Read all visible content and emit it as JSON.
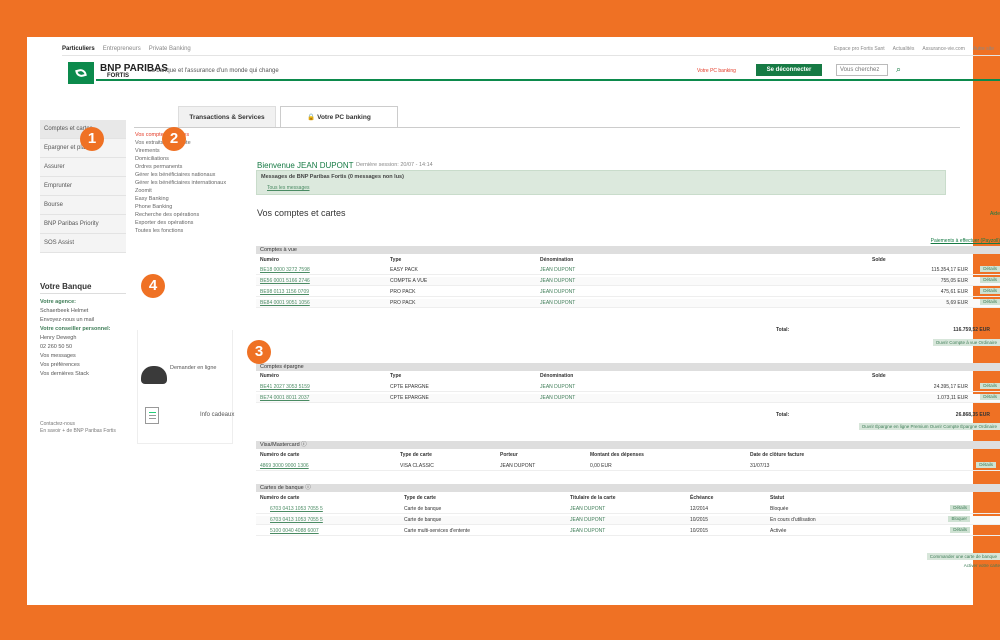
{
  "top_nav": [
    "Particuliers",
    "Entrepreneurs",
    "Private Banking"
  ],
  "top_links": [
    "Espace pro Fortis Sant",
    "Actualités",
    "Assurance-vie.com",
    "Autre site"
  ],
  "brand": {
    "line1": "BNP PARIBAS",
    "line2": "FORTIS",
    "tagline": "La banque et l'assurance d'un monde qui change"
  },
  "header": {
    "pc_link": "Votre PC banking",
    "logout": "Se déconnecter",
    "search_placeholder": "Vous cherchez"
  },
  "left_nav": [
    "Comptes et cartes",
    "Epargner et placer",
    "Assurer",
    "Emprunter",
    "Bourse",
    "BNP Paribas Priority",
    "SOS Assist"
  ],
  "votre_banque": {
    "title": "Votre Banque",
    "agence_label": "Votre agence:",
    "agence": "Schaerbeek Helmet",
    "contact": "Envoyez-nous un mail",
    "conseiller_label": "Votre conseiller personnel:",
    "conseiller": "Henry Dewegh",
    "phone": "02 260 50 50",
    "l1": "Vos messages",
    "l2": "Vos préférences",
    "l3": "Vos dernières Stack"
  },
  "left_under": {
    "l1": "Contactez-nous",
    "l2": "En savoir + de BNP Paribas Fortis"
  },
  "tabs": {
    "t1": "Transactions & Services",
    "t2": "Votre PC banking"
  },
  "menu": [
    "Vos comptes et cartes",
    "Vos extraits de compte",
    "Virements",
    "Domiciliations",
    "Ordres permanents",
    "Gérer les bénéficiaires nationaux",
    "Gérer les bénéficiaires internationaux",
    "Zoomit",
    "Easy Banking",
    "Phone Banking",
    "Recherche des opérations",
    "Exporter des opérations",
    "Toutes les fonctions"
  ],
  "sidebar_bottom": {
    "ds": "Demander en ligne",
    "info": "Info cadeaux"
  },
  "welcome": "Bienvenue JEAN DUPONT",
  "last_connection": "Dernière session: 20/07 - 14:14",
  "messages": {
    "title": "Messages de BNP Paribas Fortis (0 messages non lus)",
    "link": "Tous les messages"
  },
  "section_title": "Vos comptes et cartes",
  "aide": "Aide",
  "payments_link": "Paiements à effectuer (Payzoll)",
  "comptes": {
    "title": "Comptes à vue",
    "headers": [
      "Numéro",
      "Type",
      "Dénomination",
      "Solde"
    ],
    "rows": [
      [
        "BE18 0000 3272 7598",
        "EASY PACK",
        "JEAN DUPONT",
        "115.354,17 EUR"
      ],
      [
        "BE56 0001 5166 2746",
        "COMPTE A VUE",
        "JEAN DUPONT",
        "755,05 EUR"
      ],
      [
        "BE98 0113 1156 0709",
        "PRO PACK",
        "JEAN DUPONT",
        "475,61 EUR"
      ],
      [
        "BE84 0001 9051 1056",
        "PRO PACK",
        "JEAN DUPONT",
        "5,69 EUR"
      ]
    ],
    "total_label": "Total:",
    "total": "116.759,52 EUR",
    "more": "Ouvrir Compte à vue Ordinaire"
  },
  "epargne": {
    "title": "Comptes épargne",
    "headers": [
      "Numéro",
      "Type",
      "Dénomination",
      "Solde"
    ],
    "rows": [
      [
        "BE41 2027 3053 5159",
        "CPTE EPARGNE",
        "JEAN DUPONT",
        "24.395,17 EUR"
      ],
      [
        "BE74 0001 8011 2037",
        "CPTE EPARGNE",
        "JEAN DUPONT",
        "1.073,11 EUR"
      ]
    ],
    "total_label": "Total:",
    "total": "26.868,35 EUR",
    "more": "Ouvrir Épargne en ligne Premium  Ouvrir Compte Épargne Ordinaire"
  },
  "visa": {
    "title": "Visa/Mastercard",
    "headers": [
      "Numéro de carte",
      "Type de carte",
      "Porteur",
      "Montant des dépenses",
      "Date de clôture facture"
    ],
    "rows": [
      [
        "4869 3000 9000 1306",
        "VISA CLASSIC",
        "JEAN DUPONT",
        "0,00 EUR",
        "31/07/13"
      ]
    ],
    "btn": "Détails"
  },
  "bancaires": {
    "title": "Cartes de banque",
    "headers": [
      "Numéro de carte",
      "Type de carte",
      "Titulaire de la carte",
      "Échéance",
      "Statut"
    ],
    "rows": [
      [
        "6703 0413 1053 7055 5",
        "Carte de banque",
        "JEAN DUPONT",
        "12/2014",
        "Bloquée",
        "Détails"
      ],
      [
        "6703 0413 1053 7055 5",
        "Carte de banque",
        "JEAN DUPONT",
        "10/2015",
        "En cours d'utilisation",
        "Bloquer"
      ],
      [
        "5100 0040 4088 6007",
        "Carte multi-services d'entente",
        "JEAN DUPONT",
        "10/2015",
        "Activée",
        "Détails"
      ]
    ]
  },
  "bottom": {
    "l1": "Commander une carte de banque",
    "l2": "Activer votre carte"
  },
  "badges": [
    "1",
    "2",
    "3",
    "4"
  ]
}
